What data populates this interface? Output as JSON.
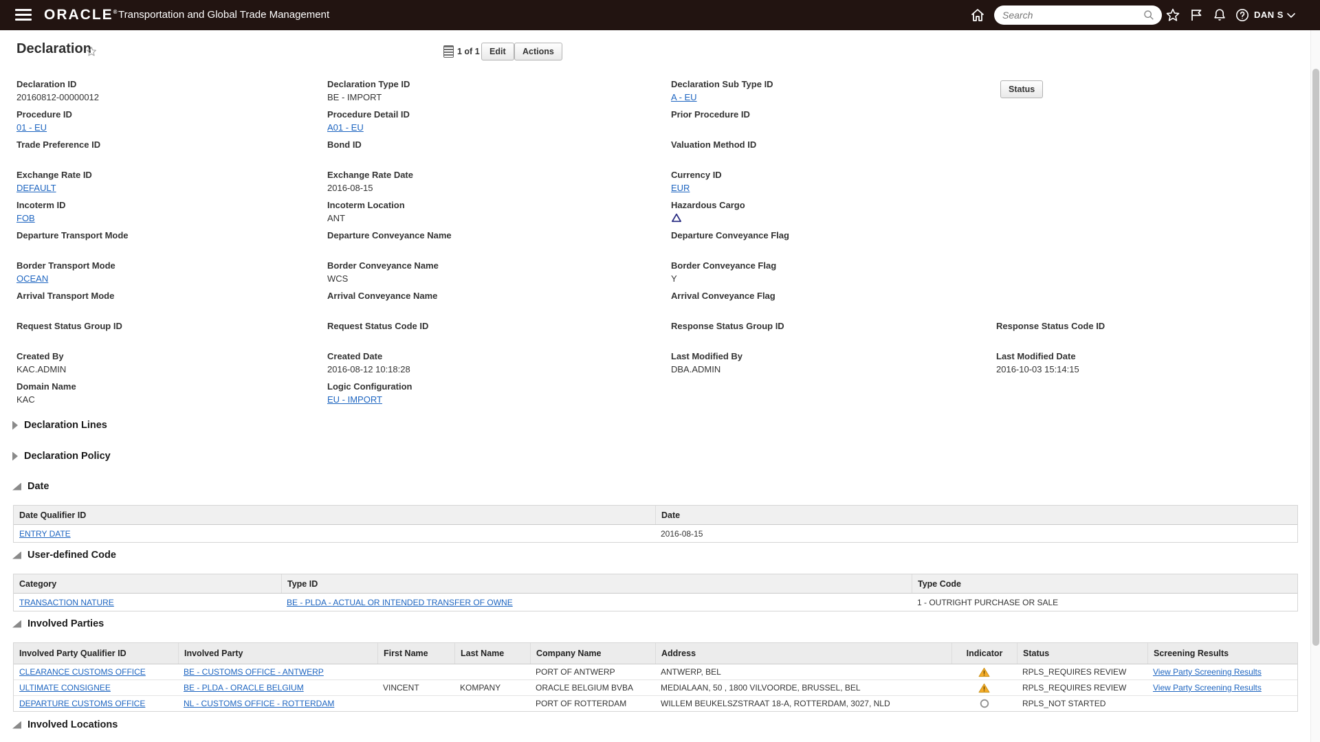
{
  "topbar": {
    "brand": "ORACLE",
    "brand_mark": "®",
    "app_title": "Transportation and Global Trade Management",
    "search_placeholder": "Search",
    "user": "DAN S",
    "icons": [
      "hamburger-icon",
      "home-icon",
      "search-icon",
      "star-icon",
      "flag-icon",
      "bell-icon",
      "help-icon",
      "chevron-down-icon"
    ],
    "bg_color": "#221411"
  },
  "titlebar": {
    "title": "Declaration",
    "pagination": "1 of 1",
    "edit_label": "Edit",
    "actions_label": "Actions",
    "status_label": "Status"
  },
  "colors": {
    "link": "#1c64c0",
    "warning": "#F2A413",
    "table_header_bg": "#f0f0f0"
  },
  "form": {
    "rows": [
      {
        "cells": [
          {
            "label": "Declaration ID",
            "value": "20160812-00000012",
            "is_link": false
          },
          {
            "label": "Declaration Type ID",
            "value": "BE - IMPORT",
            "is_link": false
          },
          {
            "label": "Declaration Sub Type ID",
            "value": "A - EU",
            "is_link": true
          }
        ]
      },
      {
        "cells": [
          {
            "label": "Procedure ID",
            "value": "01 - EU",
            "is_link": true
          },
          {
            "label": "Procedure Detail ID",
            "value": "A01 - EU",
            "is_link": true
          },
          {
            "label": "Prior Procedure ID",
            "value": "",
            "is_link": false
          }
        ]
      },
      {
        "cells": [
          {
            "label": "Trade Preference ID",
            "value": "",
            "is_link": false
          },
          {
            "label": "Bond ID",
            "value": "",
            "is_link": false
          },
          {
            "label": "Valuation Method ID",
            "value": "",
            "is_link": false
          }
        ]
      },
      {
        "cells": [
          {
            "label": "Exchange Rate ID",
            "value": "DEFAULT",
            "is_link": true
          },
          {
            "label": "Exchange Rate Date",
            "value": "2016-08-15",
            "is_link": false
          },
          {
            "label": "Currency ID",
            "value": "EUR",
            "is_link": true
          }
        ]
      },
      {
        "cells": [
          {
            "label": "Incoterm ID",
            "value": "FOB",
            "is_link": true
          },
          {
            "label": "Incoterm Location",
            "value": "ANT",
            "is_link": false
          },
          {
            "label": "Hazardous Cargo",
            "value": "",
            "is_link": false,
            "icon": "hazard-triangle-icon"
          }
        ]
      },
      {
        "cells": [
          {
            "label": "Departure Transport Mode",
            "value": "",
            "is_link": false
          },
          {
            "label": "Departure Conveyance Name",
            "value": "",
            "is_link": false
          },
          {
            "label": "Departure Conveyance Flag",
            "value": "",
            "is_link": false
          }
        ]
      },
      {
        "cells": [
          {
            "label": "Border Transport Mode",
            "value": "OCEAN",
            "is_link": true
          },
          {
            "label": "Border Conveyance Name",
            "value": "WCS",
            "is_link": false
          },
          {
            "label": "Border Conveyance Flag",
            "value": "Y",
            "is_link": false
          }
        ]
      },
      {
        "cells": [
          {
            "label": "Arrival Transport Mode",
            "value": "",
            "is_link": false
          },
          {
            "label": "Arrival Conveyance Name",
            "value": "",
            "is_link": false
          },
          {
            "label": "Arrival Conveyance Flag",
            "value": "",
            "is_link": false
          }
        ]
      },
      {
        "cells": [
          {
            "label": "Request Status Group ID",
            "value": "",
            "is_link": false
          },
          {
            "label": "Request Status Code ID",
            "value": "",
            "is_link": false
          },
          {
            "label": "Response Status Group ID",
            "value": "",
            "is_link": false
          },
          {
            "label": "Response Status Code ID",
            "value": "",
            "is_link": false
          }
        ]
      },
      {
        "cells": [
          {
            "label": "Created By",
            "value": "KAC.ADMIN",
            "is_link": false
          },
          {
            "label": "Created Date",
            "value": "2016-08-12 10:18:28",
            "is_link": false
          },
          {
            "label": "Last Modified By",
            "value": "DBA.ADMIN",
            "is_link": false
          },
          {
            "label": "Last Modified Date",
            "value": "2016-10-03 15:14:15",
            "is_link": false
          }
        ]
      },
      {
        "cells": [
          {
            "label": "Domain Name",
            "value": "KAC",
            "is_link": false
          },
          {
            "label": "Logic Configuration",
            "value": "EU - IMPORT",
            "is_link": true
          }
        ]
      }
    ]
  },
  "sections": {
    "lines": "Declaration Lines",
    "policy": "Declaration Policy",
    "date": "Date",
    "udc": "User-defined Code",
    "parties": "Involved Parties",
    "locations": "Involved Locations"
  },
  "date_table": {
    "headers": [
      "Date Qualifier ID",
      "Date"
    ],
    "rows": [
      {
        "qualifier": "ENTRY DATE",
        "date": "2016-08-15"
      }
    ]
  },
  "udc_table": {
    "headers": [
      "Category",
      "Type ID",
      "Type Code"
    ],
    "rows": [
      {
        "category": "TRANSACTION NATURE",
        "type_id": "BE - PLDA - ACTUAL OR INTENDED TRANSFER OF OWNE",
        "type_code": "1 - OUTRIGHT PURCHASE OR SALE"
      }
    ]
  },
  "parties_table": {
    "headers": [
      "Involved Party Qualifier ID",
      "Involved Party",
      "First Name",
      "Last Name",
      "Company Name",
      "Address",
      "Indicator",
      "Status",
      "Screening Results"
    ],
    "rows": [
      {
        "qualifier": "CLEARANCE CUSTOMS OFFICE",
        "party": "BE - CUSTOMS OFFICE - ANTWERP",
        "first_name": "",
        "last_name": "",
        "company": "PORT OF ANTWERP",
        "address": "ANTWERP, BEL",
        "indicator": "warning-triangle-icon",
        "status": "RPLS_REQUIRES REVIEW",
        "screening": "View Party Screening Results"
      },
      {
        "qualifier": "ULTIMATE CONSIGNEE",
        "party": "BE - PLDA - ORACLE BELGIUM",
        "first_name": "VINCENT",
        "last_name": "KOMPANY",
        "company": "ORACLE BELGIUM BVBA",
        "address": "MEDIALAAN, 50 , 1800 VILVOORDE, BRUSSEL, BEL",
        "indicator": "warning-triangle-icon",
        "status": "RPLS_REQUIRES REVIEW",
        "screening": "View Party Screening Results"
      },
      {
        "qualifier": "DEPARTURE CUSTOMS OFFICE",
        "party": "NL - CUSTOMS OFFICE - ROTTERDAM",
        "first_name": "",
        "last_name": "",
        "company": "PORT OF ROTTERDAM",
        "address": "WILLEM BEUKELSZSTRAAT 18-A, ROTTERDAM, 3027, NLD",
        "indicator": "not-started-circle-icon",
        "status": "RPLS_NOT STARTED",
        "screening": ""
      }
    ]
  }
}
